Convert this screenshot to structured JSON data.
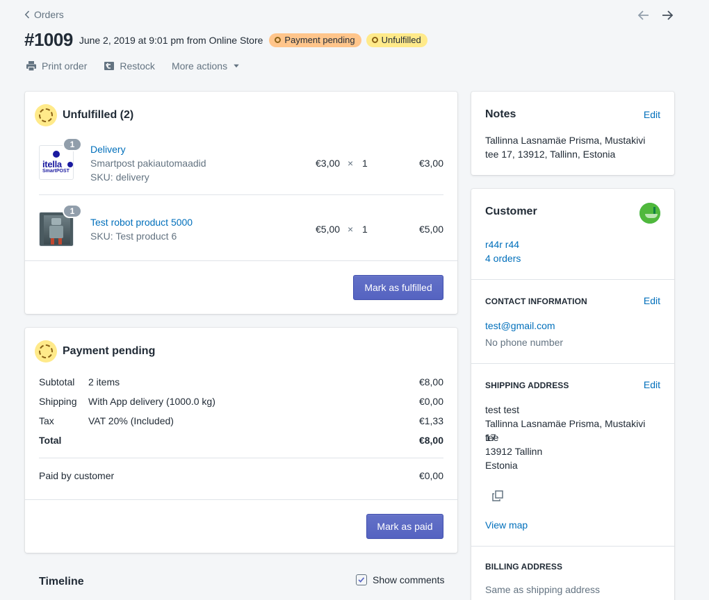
{
  "header": {
    "back_label": "Orders",
    "order_number": "#1009",
    "order_meta": "June 2, 2019 at 9:01 pm from Online Store",
    "badges": [
      {
        "label": "Payment pending",
        "color": "#ffc58b"
      },
      {
        "label": "Unfulfilled",
        "color": "#ffea8a"
      }
    ],
    "actions": [
      {
        "label": "Print order",
        "icon": "printer-icon"
      },
      {
        "label": "Restock",
        "icon": "restock-icon"
      },
      {
        "label": "More actions",
        "icon": "caret-down-icon"
      }
    ]
  },
  "fulfillment": {
    "title": "Unfulfilled (2)",
    "items": [
      {
        "qty": "1",
        "name": "Delivery",
        "variant": "Smartpost pakiautomaadid",
        "sku": "SKU: delivery",
        "unit_price": "€3,00",
        "times": "×",
        "quantity": "1",
        "total": "€3,00",
        "thumb_text": "itella",
        "thumb_sub": "SmartPOST"
      },
      {
        "qty": "1",
        "name": "Test robot product 5000",
        "sku": "SKU: Test product 6",
        "unit_price": "€5,00",
        "times": "×",
        "quantity": "1",
        "total": "€5,00"
      }
    ],
    "button": "Mark as fulfilled"
  },
  "payment": {
    "title": "Payment pending",
    "rows": [
      {
        "label": "Subtotal",
        "desc": "2 items",
        "amount": "€8,00"
      },
      {
        "label": "Shipping",
        "desc": "With App delivery (1000.0 kg)",
        "amount": "€0,00"
      },
      {
        "label": "Tax",
        "desc": "VAT 20% (Included)",
        "amount": "€1,33"
      },
      {
        "label": "Total",
        "desc": "",
        "amount": "€8,00"
      }
    ],
    "paid_label": "Paid by customer",
    "paid_amount": "€0,00",
    "button": "Mark as paid"
  },
  "timeline": {
    "title": "Timeline",
    "show_comments": "Show comments",
    "show_comments_checked": true
  },
  "notes": {
    "title": "Notes",
    "edit": "Edit",
    "text": "Tallinna Lasnamäe Prisma, Mustakivi tee 17, 13912, Tallinn, Estonia"
  },
  "customer": {
    "title": "Customer",
    "name": "r44r r44",
    "orders": "4 orders",
    "contact_heading": "CONTACT INFORMATION",
    "contact_edit": "Edit",
    "email": "test@gmail.com",
    "phone": "No phone number",
    "shipping_heading": "SHIPPING ADDRESS",
    "shipping_edit": "Edit",
    "shipping_lines": [
      "test test",
      "Tallinna Lasnamäe Prisma, Mustakivi tee",
      "17",
      "13912 Tallinn",
      "Estonia"
    ],
    "view_map": "View map",
    "billing_heading": "BILLING ADDRESS",
    "billing_text": "Same as shipping address"
  },
  "colors": {
    "accent": "#5c6ac4",
    "link": "#006fbb",
    "pending_badge": "#ffc58b",
    "unfulfilled_badge": "#ffea8a"
  }
}
